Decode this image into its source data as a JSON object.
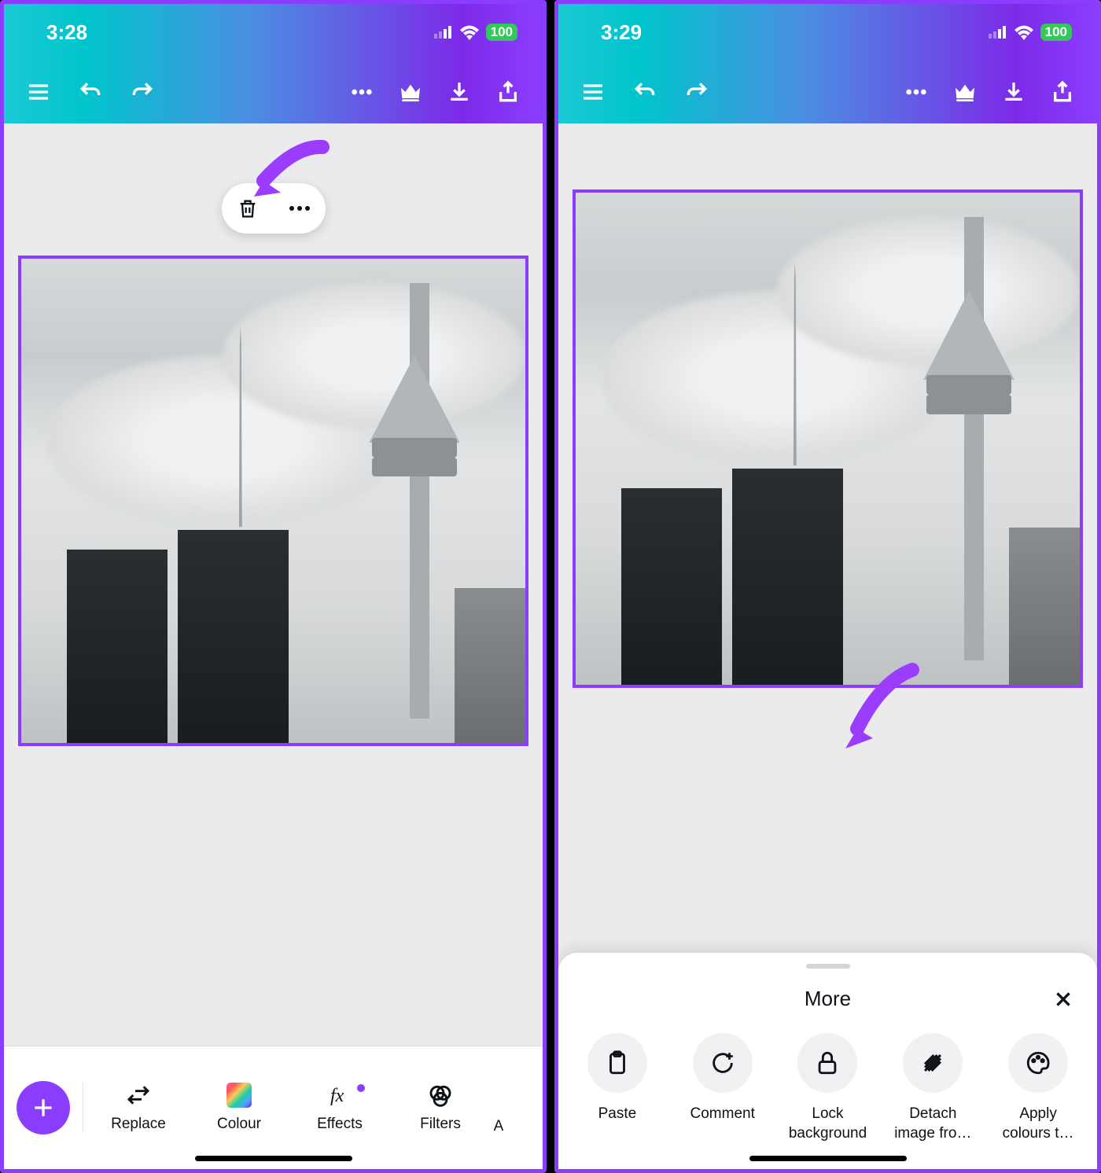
{
  "leftScreen": {
    "status": {
      "time": "3:28",
      "battery": "100"
    },
    "selection": {
      "trash": "trash",
      "more": "more"
    },
    "toolbar": {
      "replace": "Replace",
      "colour": "Colour",
      "effects": "Effects",
      "filters": "Filters",
      "overflow": "A"
    }
  },
  "rightScreen": {
    "status": {
      "time": "3:29",
      "battery": "100"
    },
    "sheet": {
      "title": "More",
      "actions": {
        "paste": "Paste",
        "comment": "Comment",
        "lock1": "Lock",
        "lock2": "background",
        "detach1": "Detach",
        "detach2": "image fro…",
        "apply1": "Apply",
        "apply2": "colours t…"
      }
    }
  }
}
